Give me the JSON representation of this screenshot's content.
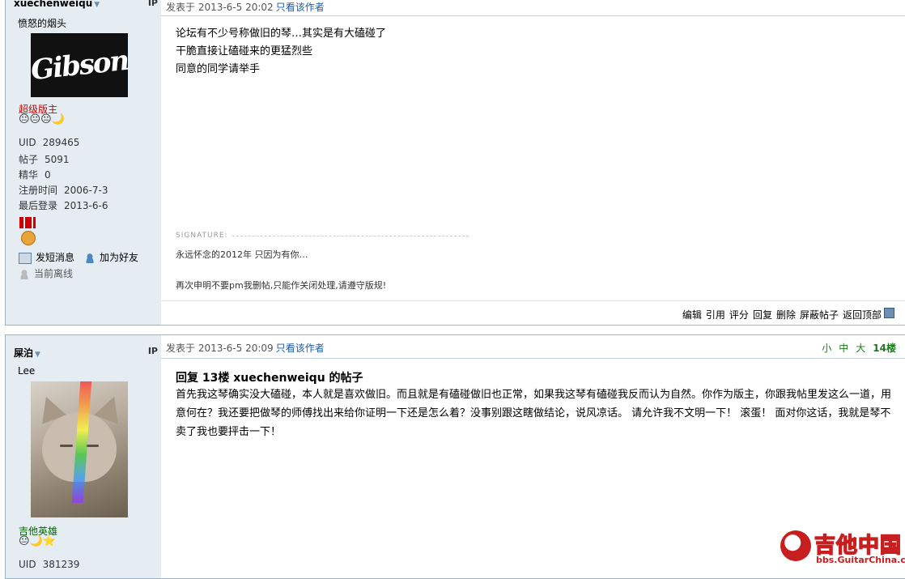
{
  "post1": {
    "author": "xuechenweiqu",
    "ip_label": "IP",
    "custom_title": "愤怒的烟头",
    "avatar_text": "Gibson",
    "rank": "超级版主",
    "rank_color": "#cc0000",
    "stars": "😐😐😐🌙",
    "stats": [
      {
        "label": "UID",
        "value": "289465"
      },
      {
        "label": "帖子",
        "value": "5091"
      },
      {
        "label": "精华",
        "value": "0"
      },
      {
        "label": "注册时间",
        "value": "2006-7-3"
      },
      {
        "label": "最后登录",
        "value": "2013-6-6"
      }
    ],
    "actions": {
      "send_message": "发短消息",
      "add_friend": "加为好友",
      "status": "当前离线"
    },
    "header": {
      "meta": "发表于 2013-6-5 20:02",
      "only_author": "只看该作者"
    },
    "body_lines": [
      "论坛有不少号称做旧的琴…其实是有大磕碰了",
      "干脆直接让磕碰来的更猛烈些",
      "同意的同学请举手"
    ],
    "signature_label": "SIGNATURE:",
    "signature_lines": [
      "永远怀念的2012年 只因为有你…",
      "再次申明不要pm我删帖,只能作关闭处理,请遵守版规!"
    ],
    "ops": [
      "编辑",
      "引用",
      "评分",
      "回复",
      "删除",
      "屏蔽帖子",
      "返回顶部"
    ]
  },
  "post2": {
    "author": "屎泊",
    "ip_label": "IP",
    "custom_title": "Lee",
    "rank": "吉他英雄",
    "rank_color": "#006600",
    "stars": "😐🌙⭐",
    "stats": [
      {
        "label": "UID",
        "value": "381239"
      }
    ],
    "header": {
      "meta": "发表于 2013-6-5 20:09",
      "only_author": "只看该作者"
    },
    "font_sizes": [
      "小",
      "中",
      "大"
    ],
    "floor": "14楼",
    "reply_title": "回复 13楼 xuechenweiqu 的帖子",
    "reply_body": "首先我这琴确实没大磕碰，本人就是喜欢做旧。而且就是有磕碰做旧也正常，如果我这琴有磕碰我反而认为自然。你作为版主，你跟我帖里发这么一道，用意何在？我还要把做琴的师傅找出来给你证明一下还是怎么着？没事别跟这瞎做结论，说风凉话。 请允许我不文明一下！ 滚蛋！ 面对你这话，我就是琴不卖了我也要抨击一下！"
  },
  "watermark": {
    "title": "吉他中国",
    "url": "bbs.GuitarChina.com"
  }
}
